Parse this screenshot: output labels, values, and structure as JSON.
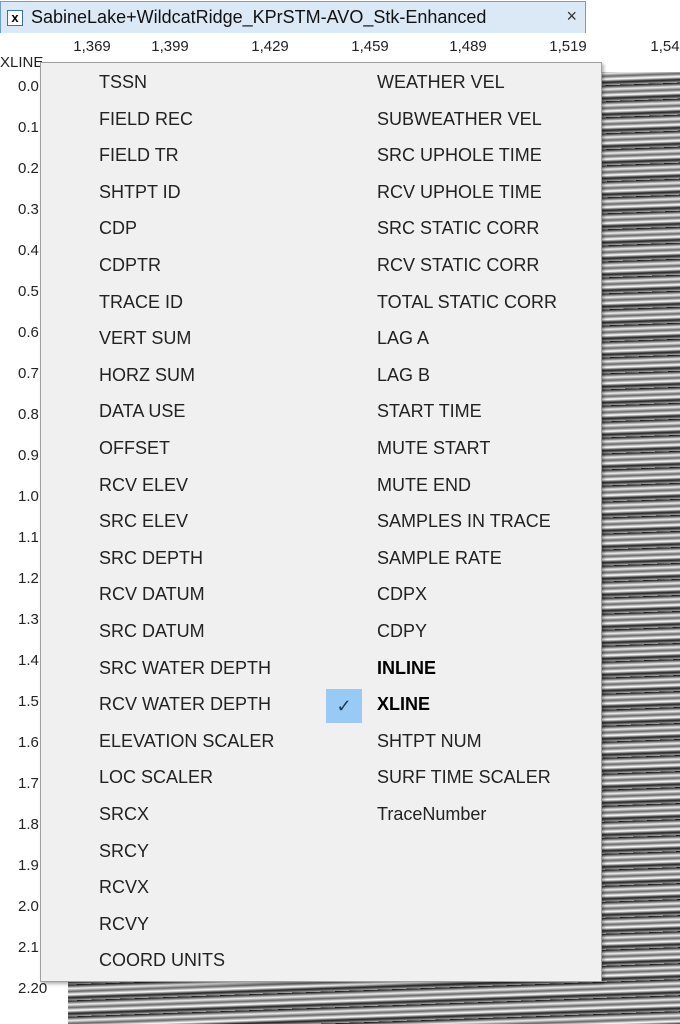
{
  "tab": {
    "title": "SabineLake+WildcatRidge_KPrSTM-AVO_Stk-Enhanced",
    "icon": "close-box-icon",
    "close": "×"
  },
  "xaxis": {
    "label": "XLINE",
    "ticks": [
      "1,369",
      "1,399",
      "1,429",
      "1,459",
      "1,489",
      "1,519",
      "1,54"
    ]
  },
  "yaxis": {
    "ticks": [
      "0.0",
      "0.1",
      "0.2",
      "0.3",
      "0.4",
      "0.5",
      "0.6",
      "0.7",
      "0.8",
      "0.9",
      "1.0",
      "1.1",
      "1.2",
      "1.3",
      "1.4",
      "1.5",
      "1.6",
      "1.7",
      "1.8",
      "1.9",
      "2.0",
      "2.1",
      "2.20"
    ]
  },
  "menu": {
    "left": [
      "TSSN",
      "FIELD REC",
      "FIELD TR",
      "SHTPT ID",
      "CDP",
      "CDPTR",
      "TRACE ID",
      "VERT SUM",
      "HORZ SUM",
      "DATA USE",
      "OFFSET",
      "RCV ELEV",
      "SRC ELEV",
      "SRC DEPTH",
      "RCV DATUM",
      "SRC DATUM",
      "SRC WATER DEPTH",
      "RCV WATER DEPTH",
      "ELEVATION SCALER",
      "LOC SCALER",
      "SRCX",
      "SRCY",
      "RCVX",
      "RCVY",
      "COORD UNITS"
    ],
    "right": [
      "WEATHER VEL",
      "SUBWEATHER VEL",
      "SRC UPHOLE TIME",
      "RCV UPHOLE TIME",
      "SRC STATIC CORR",
      "RCV STATIC CORR",
      "TOTAL STATIC CORR",
      "LAG A",
      "LAG B",
      "START TIME",
      "MUTE START",
      "MUTE END",
      "SAMPLES IN TRACE",
      "SAMPLE RATE",
      "CDPX",
      "CDPY",
      "INLINE",
      "XLINE",
      "SHTPT NUM",
      "SURF TIME SCALER",
      "TraceNumber"
    ],
    "bold_items": [
      "INLINE",
      "XLINE"
    ],
    "checked_item": "XLINE",
    "check_glyph": "✓",
    "check_color": "#99c9f5"
  }
}
